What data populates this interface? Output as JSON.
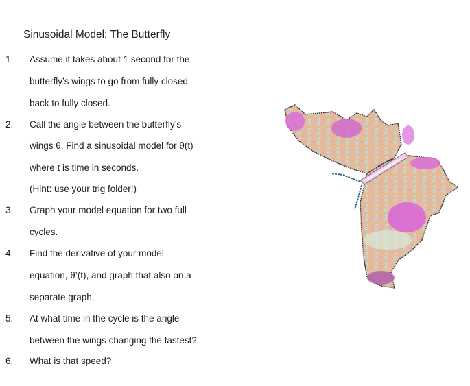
{
  "document": {
    "title": "Sinusoidal Model:  The Butterfly",
    "items": [
      {
        "number": "1.",
        "lines": [
          "Assume it takes about 1 second for the",
          "butterfly’s wings to go from fully closed",
          "back to fully closed."
        ]
      },
      {
        "number": "2.",
        "lines": [
          "Call the angle between the butterfly’s",
          "wings θ.  Find a sinusoidal model for θ(t)",
          "where t is time in seconds.",
          "(Hint: use your trig folder!)"
        ]
      },
      {
        "number": "3.",
        "lines": [
          "Graph your model equation for two full",
          "cycles."
        ]
      },
      {
        "number": "4.",
        "lines": [
          "Find the derivative of your model",
          "equation, θ’(t), and graph that also on a",
          "separate graph."
        ]
      },
      {
        "number": "5.",
        "lines": [
          "At what time in the cycle is the angle",
          "between the wings changing the fastest?"
        ]
      },
      {
        "number": "6.",
        "lines": [
          "What is that speed?"
        ]
      }
    ]
  },
  "image": {
    "subject": "butterfly-illustration",
    "colors": {
      "pink": "#d96fd6",
      "peach": "#e8b39a",
      "mint": "#b9dcc6",
      "tan": "#d4b58c",
      "outline": "#3a3a3a"
    }
  }
}
